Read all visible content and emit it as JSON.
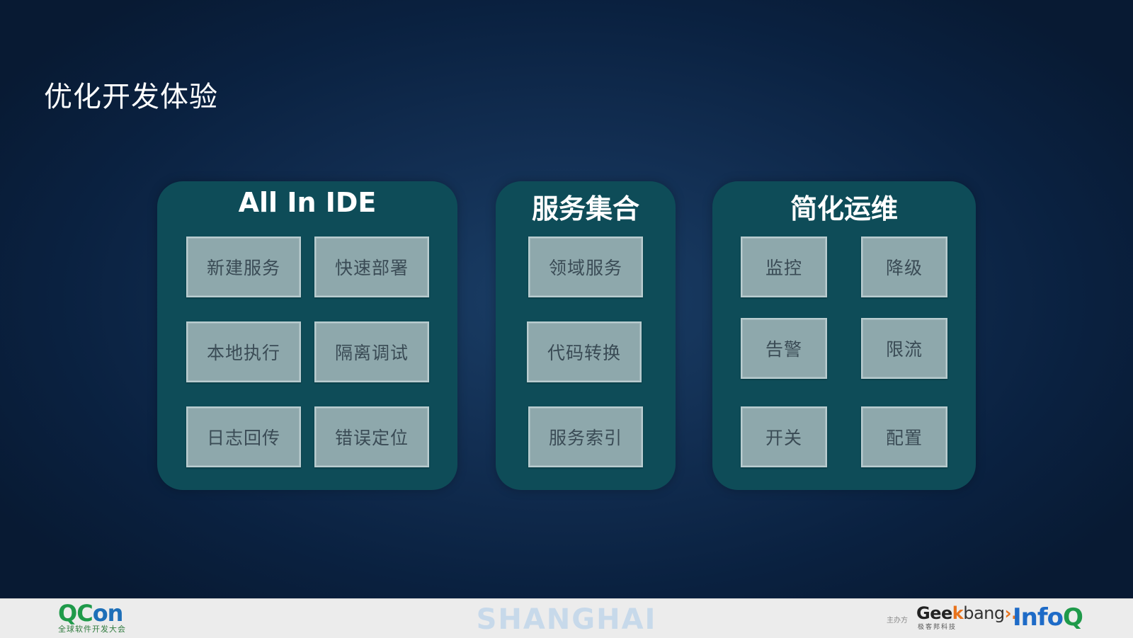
{
  "slide": {
    "title": "优化开发体验"
  },
  "groups": [
    {
      "title": "All In IDE",
      "items": [
        "新建服务",
        "快速部署",
        "本地执行",
        "隔离调试",
        "日志回传",
        "错误定位"
      ]
    },
    {
      "title": "服务集合",
      "items": [
        "领域服务",
        "代码转换",
        "服务索引"
      ]
    },
    {
      "title": "简化运维",
      "items": [
        "监控",
        "降级",
        "告警",
        "限流",
        "开关",
        "配置"
      ]
    }
  ],
  "footer": {
    "qcon_logo_q": "QC",
    "qcon_logo_rest": "on",
    "qcon_subtitle": "全球软件开发大会",
    "city": "SHANGHAI",
    "host_label": "主办方",
    "geek_a": "Gee",
    "geek_k": "k",
    "geek_bang": "bang",
    "geek_arrow": "›.",
    "geek_subtitle": "极客邦科技",
    "infoq_a": "Info",
    "infoq_q": "Q"
  }
}
